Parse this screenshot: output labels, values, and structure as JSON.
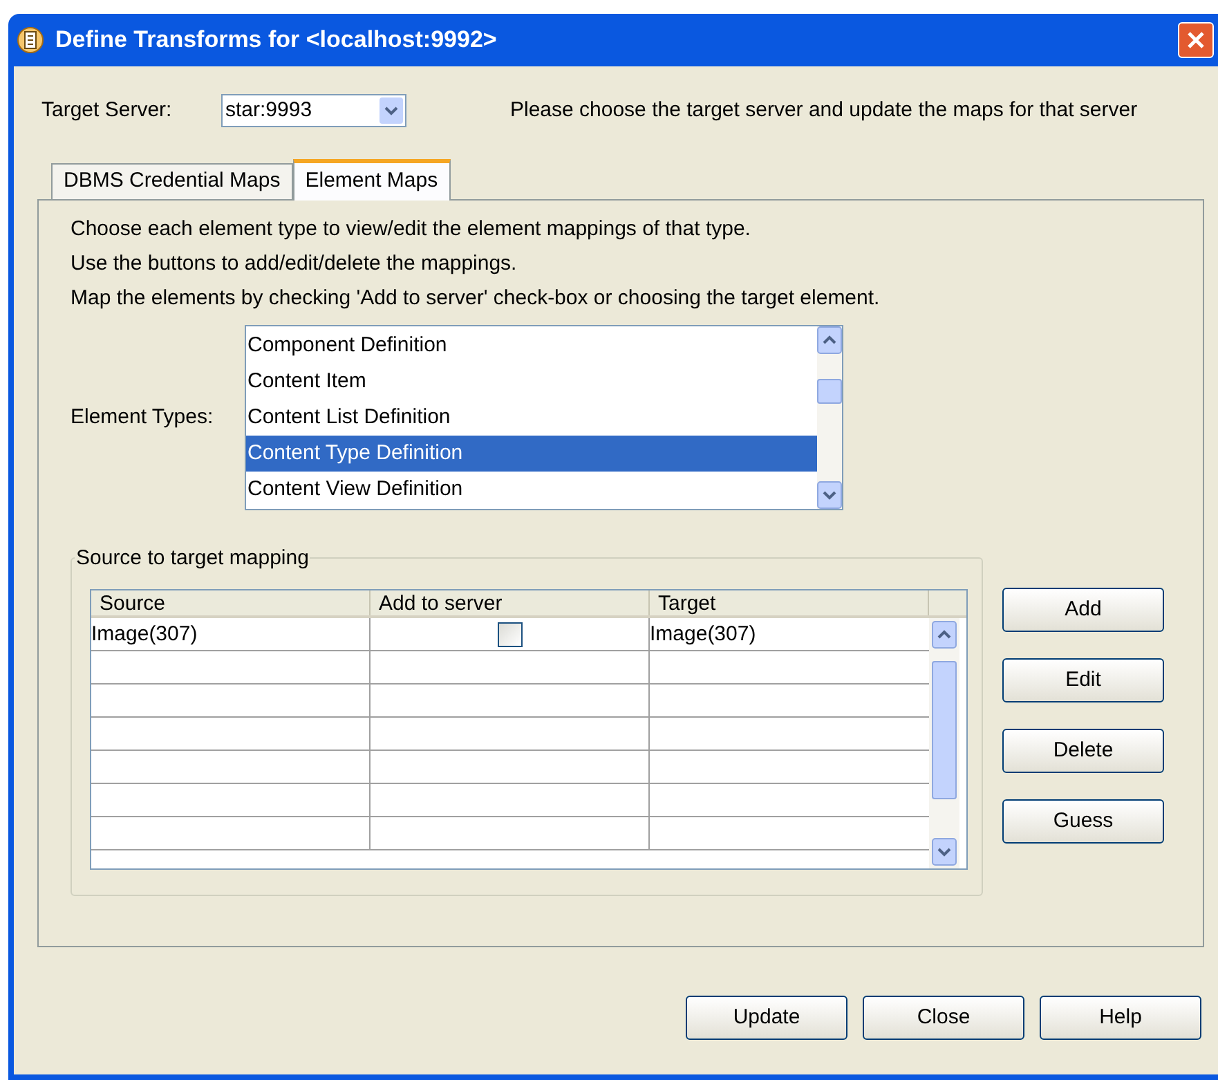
{
  "window": {
    "title": "Define Transforms for <localhost:9992>"
  },
  "target_server": {
    "label": "Target Server:",
    "value": "star:9993",
    "hint": "Please choose the target server and update the maps for that server"
  },
  "tabs": [
    {
      "label": "DBMS Credential Maps",
      "selected": false
    },
    {
      "label": "Element Maps",
      "selected": true
    }
  ],
  "instructions": [
    "Choose each element type to view/edit the element mappings of that type.",
    "Use the buttons to add/edit/delete the mappings.",
    "Map the elements by checking 'Add to server' check-box or choosing the target element."
  ],
  "element_types": {
    "label": "Element Types:",
    "items": [
      {
        "label": "Component Definition",
        "selected": false
      },
      {
        "label": "Content Item",
        "selected": false
      },
      {
        "label": "Content List Definition",
        "selected": false
      },
      {
        "label": "Content Type Definition",
        "selected": true
      },
      {
        "label": "Content View Definition",
        "selected": false
      }
    ]
  },
  "mapping": {
    "title": "Source to target mapping",
    "columns": [
      "Source",
      "Add to server",
      "Target"
    ],
    "rows": [
      {
        "source": "Image(307)",
        "add_to_server": false,
        "target": "Image(307)"
      }
    ]
  },
  "side_buttons": [
    "Add",
    "Edit",
    "Delete",
    "Guess"
  ],
  "buttons": [
    "Update",
    "Close",
    "Help"
  ]
}
